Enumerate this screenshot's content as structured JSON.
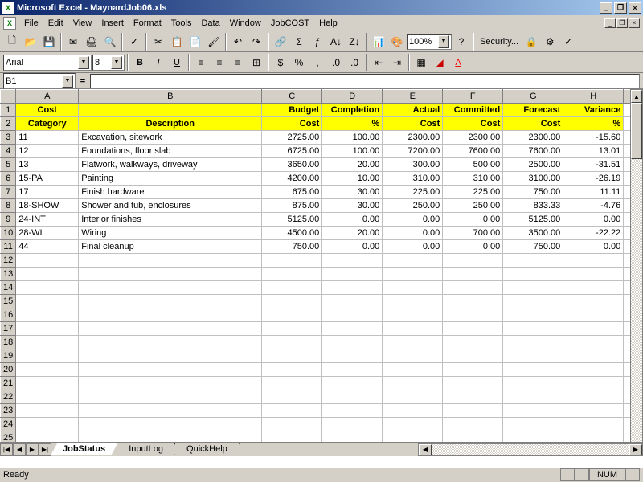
{
  "app": {
    "title": "Microsoft Excel - MaynardJob06.xls"
  },
  "menu": [
    "File",
    "Edit",
    "View",
    "Insert",
    "Format",
    "Tools",
    "Data",
    "Window",
    "JobCOST",
    "Help"
  ],
  "namebox": "B1",
  "font": "Arial",
  "fontsize": "8",
  "zoom": "100%",
  "security": "Security...",
  "headers": {
    "r1": {
      "A": "Cost",
      "B": "",
      "C": "Budget",
      "D": "Completion",
      "E": "Actual",
      "F": "Committed",
      "G": "Forecast",
      "H": "Variance"
    },
    "r2": {
      "A": "Category",
      "B": "Description",
      "C": "Cost",
      "D": "%",
      "E": "Cost",
      "F": "Cost",
      "G": "Cost",
      "H": "%"
    }
  },
  "rows": [
    {
      "A": "11",
      "B": "Excavation, sitework",
      "C": "2725.00",
      "D": "100.00",
      "E": "2300.00",
      "F": "2300.00",
      "G": "2300.00",
      "H": "-15.60"
    },
    {
      "A": "12",
      "B": "Foundations, floor slab",
      "C": "6725.00",
      "D": "100.00",
      "E": "7200.00",
      "F": "7600.00",
      "G": "7600.00",
      "H": "13.01"
    },
    {
      "A": "13",
      "B": "Flatwork, walkways, driveway",
      "C": "3650.00",
      "D": "20.00",
      "E": "300.00",
      "F": "500.00",
      "G": "2500.00",
      "H": "-31.51"
    },
    {
      "A": "15-PA",
      "B": "Painting",
      "C": "4200.00",
      "D": "10.00",
      "E": "310.00",
      "F": "310.00",
      "G": "3100.00",
      "H": "-26.19"
    },
    {
      "A": "17",
      "B": "Finish hardware",
      "C": "675.00",
      "D": "30.00",
      "E": "225.00",
      "F": "225.00",
      "G": "750.00",
      "H": "11.11"
    },
    {
      "A": "18-SHOW",
      "B": "Shower and tub, enclosures",
      "C": "875.00",
      "D": "30.00",
      "E": "250.00",
      "F": "250.00",
      "G": "833.33",
      "H": "-4.76"
    },
    {
      "A": "24-INT",
      "B": "Interior finishes",
      "C": "5125.00",
      "D": "0.00",
      "E": "0.00",
      "F": "0.00",
      "G": "5125.00",
      "H": "0.00"
    },
    {
      "A": "28-WI",
      "B": "Wiring",
      "C": "4500.00",
      "D": "20.00",
      "E": "0.00",
      "F": "700.00",
      "G": "3500.00",
      "H": "-22.22"
    },
    {
      "A": "44",
      "B": "Final cleanup",
      "C": "750.00",
      "D": "0.00",
      "E": "0.00",
      "F": "0.00",
      "G": "750.00",
      "H": "0.00"
    }
  ],
  "tabs": [
    "JobStatus",
    "InputLog",
    "QuickHelp"
  ],
  "status": {
    "ready": "Ready",
    "num": "NUM"
  }
}
